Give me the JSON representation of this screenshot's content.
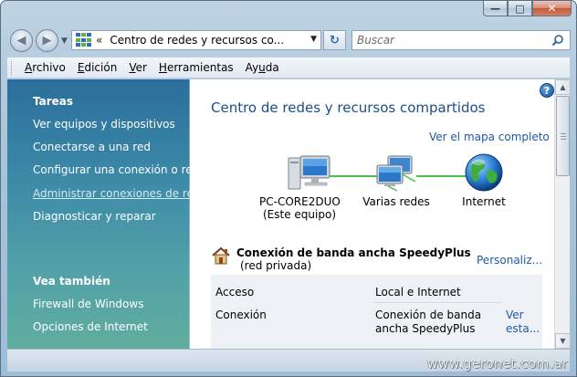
{
  "window": {
    "caption_buttons": [
      {
        "name": "minimize-button",
        "glyph": "—"
      },
      {
        "name": "maximize-button",
        "glyph": "□"
      },
      {
        "name": "close-button",
        "glyph": "✕"
      }
    ]
  },
  "navigation": {
    "back_glyph": "◀",
    "forward_glyph": "▶",
    "history_dropdown_glyph": "▼",
    "address": {
      "prefix": "«",
      "text": "Centro de redes y recursos co...",
      "dropdown_glyph": "▼"
    },
    "refresh_glyph": "↻",
    "search": {
      "placeholder": "Buscar"
    }
  },
  "menubar": {
    "items": [
      {
        "underline": "A",
        "rest": "rchivo"
      },
      {
        "underline": "E",
        "rest": "dición"
      },
      {
        "underline": "V",
        "rest": "er"
      },
      {
        "underline": "H",
        "rest": "erramientas"
      },
      {
        "underline": "",
        "rest": "Ay",
        "underline2": "u",
        "rest2": "da"
      }
    ]
  },
  "sidebar": {
    "tasks_heading": "Tareas",
    "tasks": [
      "Ver equipos y dispositivos",
      "Conectarse a una red",
      "Configurar una conexión o red",
      "Administrar conexiones de red",
      "Diagnosticar y reparar"
    ],
    "see_also_heading": "Vea también",
    "see_also": [
      "Firewall de Windows",
      "Opciones de Internet"
    ]
  },
  "main": {
    "help_glyph": "?",
    "title": "Centro de redes y recursos compartidos",
    "full_map_link": "Ver el mapa completo",
    "network_map": {
      "nodes": [
        {
          "label_line1": "PC-CORE2DUO",
          "label_line2": "(Este equipo)",
          "icon": "computer-icon"
        },
        {
          "label_line1": "Varias redes",
          "label_line2": "",
          "icon": "network-icon"
        },
        {
          "label_line1": "Internet",
          "label_line2": "",
          "icon": "globe-icon"
        }
      ]
    },
    "connection": {
      "name": "Conexión de banda ancha SpeedyPlus",
      "type": "(red privada)",
      "customize_link": "Personaliz...",
      "icon": "house-icon",
      "rows": [
        {
          "key": "Acceso",
          "value": "Local e Internet",
          "link": ""
        },
        {
          "key": "Conexión",
          "value": "Conexión de banda ancha SpeedyPlus",
          "link": "Ver esta..."
        }
      ]
    }
  },
  "scrollbar": {
    "up_glyph": "▲",
    "down_glyph": "▼"
  },
  "watermark": "www.geronet.com.ar",
  "colors": {
    "link": "#1e58a8",
    "title": "#1b4e8a",
    "sidebar_top": "#2b6e9c",
    "sidebar_bottom": "#60ad9e"
  }
}
